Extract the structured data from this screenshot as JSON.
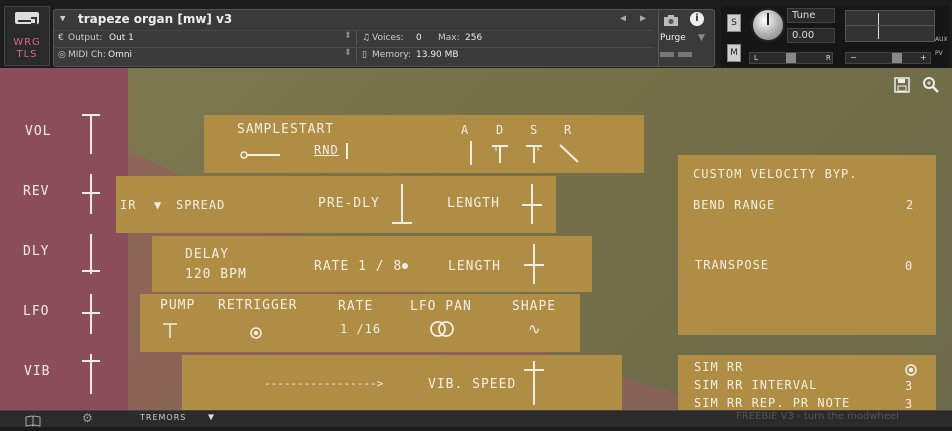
{
  "header": {
    "tools_label": "WRG\nTLS",
    "instrument_title": "trapeze organ [mw] v3",
    "output_label": "Output:",
    "output_value": "Out 1",
    "voices_label": "Voices:",
    "voices_value": "0",
    "max_label": "Max:",
    "max_value": "256",
    "midi_label": "MIDI Ch:",
    "midi_value": "Omni",
    "memory_label": "Memory:",
    "memory_value": "13.90 MB",
    "purge_label": "Purge",
    "s_button": "S",
    "m_button": "M",
    "tune_label": "Tune",
    "tune_value": "0.00",
    "pan_left": "L",
    "pan_right": "R",
    "aux_label": "AUX",
    "pv_label": "PV",
    "vol_minus": "−",
    "vol_plus": "+"
  },
  "sidebar": {
    "items": [
      {
        "label": "VOL"
      },
      {
        "label": "REV"
      },
      {
        "label": "DLY"
      },
      {
        "label": "LFO"
      },
      {
        "label": "VIB"
      }
    ]
  },
  "vol_panel": {
    "samplestart": "SAMPLESTART",
    "rnd": "RND",
    "a": "A",
    "d": "D",
    "s": "S",
    "r": "R"
  },
  "rev_panel": {
    "ir": "IR",
    "spread": "SPREAD",
    "predly": "PRE-DLY",
    "length": "LENGTH"
  },
  "dly_panel": {
    "delay": "DELAY",
    "bpm": "120 BPM",
    "rate": "RATE 1 / 8",
    "length": "LENGTH"
  },
  "lfo_panel": {
    "pump": "PUMP",
    "retrigger": "RETRIGGER",
    "rate": "RATE",
    "rate_value": "1 /16",
    "lfo_pan": "LFO PAN",
    "shape": "SHAPE",
    "shape_symbol": "∿"
  },
  "vib_panel": {
    "arrow": "----------------->",
    "speed": "VIB. SPEED"
  },
  "right_panel": {
    "custom_velocity": "CUSTOM VELOCITY BYP.",
    "bend_range": "BEND RANGE",
    "bend_value": "2",
    "transpose": "TRANSPOSE",
    "transpose_value": "0"
  },
  "sim_panel": {
    "sim_rr": "SIM RR",
    "interval": "SIM RR INTERVAL",
    "interval_value": "3",
    "rep": "SIM RR REP. PR NOTE",
    "rep_value": "3"
  },
  "footer": {
    "tremors": "TREMORS",
    "freebie": "FREEBIE V3 - turn the modwheel"
  }
}
